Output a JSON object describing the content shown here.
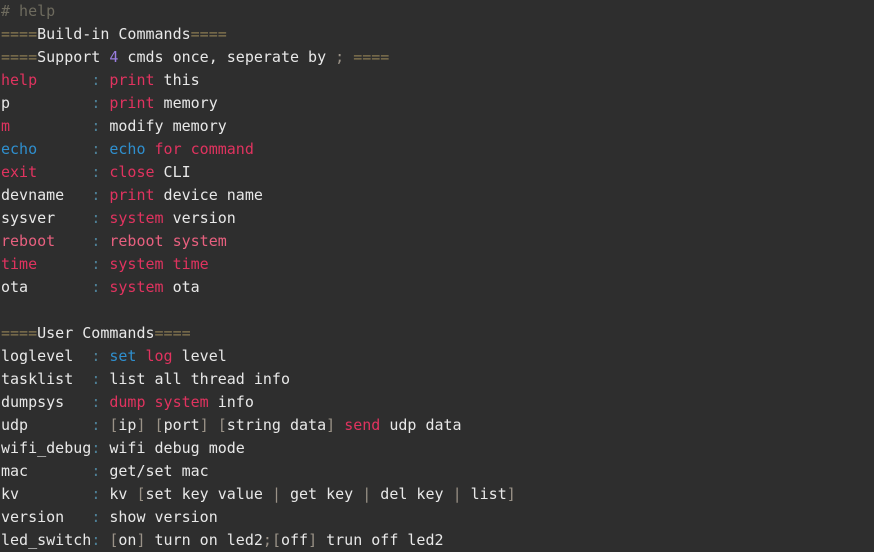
{
  "terminal": {
    "background_color": "#2e2e2e",
    "colors": {
      "comment": "#6e6b5e",
      "separator": "#8a7a52",
      "white": "#e8e8e8",
      "crimson": "#e0335f",
      "salmon": "#e8607f",
      "blue": "#2f8fce",
      "purple": "#9a7ee0",
      "colon": "#4d7f96",
      "dim": "#9a9287"
    },
    "prompt_line": "# help",
    "lines": [
      {
        "name": "prompt-line",
        "tokens": [
          {
            "text": "# help",
            "color": "comment"
          }
        ]
      },
      {
        "name": "builtin-header-line",
        "tokens": [
          {
            "text": "====",
            "color": "separator"
          },
          {
            "text": "Build-in Commands",
            "color": "white"
          },
          {
            "text": "====",
            "color": "separator"
          }
        ]
      },
      {
        "name": "support-note-line",
        "tokens": [
          {
            "text": "====",
            "color": "separator"
          },
          {
            "text": "Support ",
            "color": "white"
          },
          {
            "text": "4",
            "color": "purple"
          },
          {
            "text": " cmds once, seperate by ",
            "color": "white"
          },
          {
            "text": ";",
            "color": "dim"
          },
          {
            "text": " ",
            "color": "white"
          },
          {
            "text": "====",
            "color": "separator"
          }
        ]
      },
      {
        "name": "cmd-row-help",
        "tokens": [
          {
            "text": "help",
            "color": "crimson"
          },
          {
            "text": "      ",
            "color": "white"
          },
          {
            "text": ":",
            "color": "colon"
          },
          {
            "text": " ",
            "color": "white"
          },
          {
            "text": "print",
            "color": "crimson"
          },
          {
            "text": " this",
            "color": "white"
          }
        ]
      },
      {
        "name": "cmd-row-p",
        "tokens": [
          {
            "text": "p",
            "color": "white"
          },
          {
            "text": "         ",
            "color": "white"
          },
          {
            "text": ":",
            "color": "colon"
          },
          {
            "text": " ",
            "color": "white"
          },
          {
            "text": "print",
            "color": "crimson"
          },
          {
            "text": " memory",
            "color": "white"
          }
        ]
      },
      {
        "name": "cmd-row-m",
        "tokens": [
          {
            "text": "m",
            "color": "crimson"
          },
          {
            "text": "         ",
            "color": "white"
          },
          {
            "text": ":",
            "color": "colon"
          },
          {
            "text": " modify memory",
            "color": "white"
          }
        ]
      },
      {
        "name": "cmd-row-echo",
        "tokens": [
          {
            "text": "echo",
            "color": "blue"
          },
          {
            "text": "      ",
            "color": "white"
          },
          {
            "text": ":",
            "color": "colon"
          },
          {
            "text": " ",
            "color": "white"
          },
          {
            "text": "echo",
            "color": "blue"
          },
          {
            "text": " ",
            "color": "white"
          },
          {
            "text": "for command",
            "color": "crimson"
          }
        ]
      },
      {
        "name": "cmd-row-exit",
        "tokens": [
          {
            "text": "exit",
            "color": "crimson"
          },
          {
            "text": "      ",
            "color": "white"
          },
          {
            "text": ":",
            "color": "colon"
          },
          {
            "text": " ",
            "color": "white"
          },
          {
            "text": "close",
            "color": "crimson"
          },
          {
            "text": " CLI",
            "color": "white"
          }
        ]
      },
      {
        "name": "cmd-row-devname",
        "tokens": [
          {
            "text": "devname",
            "color": "white"
          },
          {
            "text": "   ",
            "color": "white"
          },
          {
            "text": ":",
            "color": "colon"
          },
          {
            "text": " ",
            "color": "white"
          },
          {
            "text": "print",
            "color": "crimson"
          },
          {
            "text": " device name",
            "color": "white"
          }
        ]
      },
      {
        "name": "cmd-row-sysver",
        "tokens": [
          {
            "text": "sysver",
            "color": "white"
          },
          {
            "text": "    ",
            "color": "white"
          },
          {
            "text": ":",
            "color": "colon"
          },
          {
            "text": " ",
            "color": "white"
          },
          {
            "text": "system",
            "color": "crimson"
          },
          {
            "text": " version",
            "color": "white"
          }
        ]
      },
      {
        "name": "cmd-row-reboot",
        "tokens": [
          {
            "text": "reboot",
            "color": "salmon"
          },
          {
            "text": "    ",
            "color": "white"
          },
          {
            "text": ":",
            "color": "colon"
          },
          {
            "text": " ",
            "color": "white"
          },
          {
            "text": "reboot system",
            "color": "salmon"
          }
        ]
      },
      {
        "name": "cmd-row-time",
        "tokens": [
          {
            "text": "time",
            "color": "crimson"
          },
          {
            "text": "      ",
            "color": "white"
          },
          {
            "text": ":",
            "color": "colon"
          },
          {
            "text": " ",
            "color": "white"
          },
          {
            "text": "system time",
            "color": "crimson"
          }
        ]
      },
      {
        "name": "cmd-row-ota",
        "tokens": [
          {
            "text": "ota",
            "color": "white"
          },
          {
            "text": "       ",
            "color": "white"
          },
          {
            "text": ":",
            "color": "colon"
          },
          {
            "text": " ",
            "color": "white"
          },
          {
            "text": "system",
            "color": "crimson"
          },
          {
            "text": " ota",
            "color": "white"
          }
        ]
      },
      {
        "name": "blank-line-1",
        "tokens": [
          {
            "text": " ",
            "color": "white"
          }
        ]
      },
      {
        "name": "user-header-line",
        "tokens": [
          {
            "text": "====",
            "color": "separator"
          },
          {
            "text": "User Commands",
            "color": "white"
          },
          {
            "text": "====",
            "color": "separator"
          }
        ]
      },
      {
        "name": "cmd-row-loglevel",
        "tokens": [
          {
            "text": "loglevel",
            "color": "white"
          },
          {
            "text": "  ",
            "color": "white"
          },
          {
            "text": ":",
            "color": "colon"
          },
          {
            "text": " ",
            "color": "white"
          },
          {
            "text": "set",
            "color": "blue"
          },
          {
            "text": " ",
            "color": "white"
          },
          {
            "text": "log",
            "color": "crimson"
          },
          {
            "text": " level",
            "color": "white"
          }
        ]
      },
      {
        "name": "cmd-row-tasklist",
        "tokens": [
          {
            "text": "tasklist",
            "color": "white"
          },
          {
            "text": "  ",
            "color": "white"
          },
          {
            "text": ":",
            "color": "colon"
          },
          {
            "text": " list all thread info",
            "color": "white"
          }
        ]
      },
      {
        "name": "cmd-row-dumpsys",
        "tokens": [
          {
            "text": "dumpsys",
            "color": "white"
          },
          {
            "text": "   ",
            "color": "white"
          },
          {
            "text": ":",
            "color": "colon"
          },
          {
            "text": " ",
            "color": "white"
          },
          {
            "text": "dump system",
            "color": "crimson"
          },
          {
            "text": " info",
            "color": "white"
          }
        ]
      },
      {
        "name": "cmd-row-udp",
        "tokens": [
          {
            "text": "udp",
            "color": "white"
          },
          {
            "text": "       ",
            "color": "white"
          },
          {
            "text": ":",
            "color": "colon"
          },
          {
            "text": " ",
            "color": "white"
          },
          {
            "text": "[",
            "color": "dim"
          },
          {
            "text": "ip",
            "color": "white"
          },
          {
            "text": "]",
            "color": "dim"
          },
          {
            "text": " ",
            "color": "white"
          },
          {
            "text": "[",
            "color": "dim"
          },
          {
            "text": "port",
            "color": "white"
          },
          {
            "text": "]",
            "color": "dim"
          },
          {
            "text": " ",
            "color": "white"
          },
          {
            "text": "[",
            "color": "dim"
          },
          {
            "text": "string data",
            "color": "white"
          },
          {
            "text": "]",
            "color": "dim"
          },
          {
            "text": " ",
            "color": "white"
          },
          {
            "text": "send",
            "color": "crimson"
          },
          {
            "text": " udp data",
            "color": "white"
          }
        ]
      },
      {
        "name": "cmd-row-wifi-debug",
        "tokens": [
          {
            "text": "wifi_debug",
            "color": "white"
          },
          {
            "text": ":",
            "color": "colon"
          },
          {
            "text": " wifi debug mode",
            "color": "white"
          }
        ]
      },
      {
        "name": "cmd-row-mac",
        "tokens": [
          {
            "text": "mac",
            "color": "white"
          },
          {
            "text": "       ",
            "color": "white"
          },
          {
            "text": ":",
            "color": "colon"
          },
          {
            "text": " get/set mac",
            "color": "white"
          }
        ]
      },
      {
        "name": "cmd-row-kv",
        "tokens": [
          {
            "text": "kv",
            "color": "white"
          },
          {
            "text": "        ",
            "color": "white"
          },
          {
            "text": ":",
            "color": "colon"
          },
          {
            "text": " kv ",
            "color": "white"
          },
          {
            "text": "[",
            "color": "dim"
          },
          {
            "text": "set key value ",
            "color": "white"
          },
          {
            "text": "|",
            "color": "dim"
          },
          {
            "text": " get key ",
            "color": "white"
          },
          {
            "text": "|",
            "color": "dim"
          },
          {
            "text": " del key ",
            "color": "white"
          },
          {
            "text": "|",
            "color": "dim"
          },
          {
            "text": " list",
            "color": "white"
          },
          {
            "text": "]",
            "color": "dim"
          }
        ]
      },
      {
        "name": "cmd-row-version",
        "tokens": [
          {
            "text": "version",
            "color": "white"
          },
          {
            "text": "   ",
            "color": "white"
          },
          {
            "text": ":",
            "color": "colon"
          },
          {
            "text": " show version",
            "color": "white"
          }
        ]
      },
      {
        "name": "cmd-row-led-switch",
        "tokens": [
          {
            "text": "led_switch",
            "color": "white"
          },
          {
            "text": ":",
            "color": "colon"
          },
          {
            "text": " ",
            "color": "white"
          },
          {
            "text": "[",
            "color": "dim"
          },
          {
            "text": "on",
            "color": "white"
          },
          {
            "text": "]",
            "color": "dim"
          },
          {
            "text": " turn on led2",
            "color": "white"
          },
          {
            "text": ";",
            "color": "dim"
          },
          {
            "text": "[",
            "color": "dim"
          },
          {
            "text": "off",
            "color": "white"
          },
          {
            "text": "]",
            "color": "dim"
          },
          {
            "text": " trun off led2",
            "color": "white"
          }
        ]
      }
    ]
  }
}
